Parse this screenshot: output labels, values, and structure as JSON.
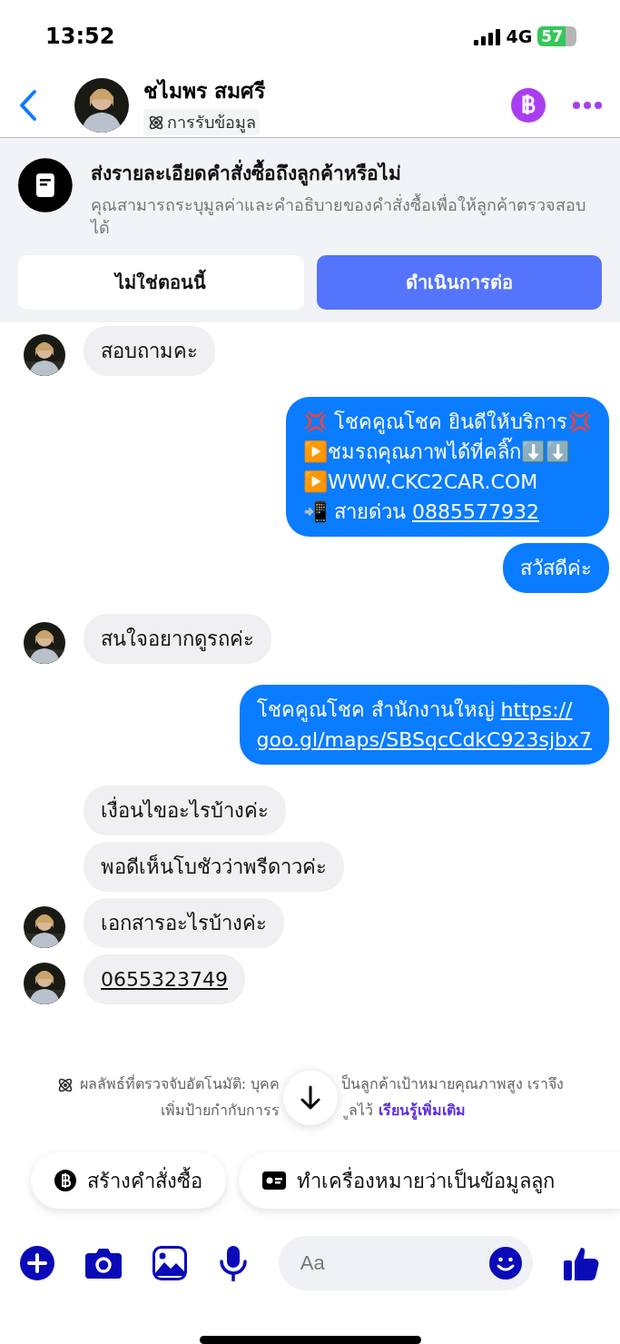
{
  "status_bar": {
    "time": "13:52",
    "network": "4G",
    "battery": "57"
  },
  "header": {
    "name": "ชไมพร สมศรี",
    "label": "การรับข้อมูล"
  },
  "banner": {
    "title": "ส่งรายละเอียดคำสั่งซื้อถึงลูกค้าหรือไม่",
    "body": "คุณสามารถระบุมูลค่าและคำอธิบายของคำสั่งซื้อเพื่อให้ลูกค้าตรวจสอบได้",
    "buttons": [
      {
        "label": "ไม่ใช่ตอนนี้",
        "kind": "secondary"
      },
      {
        "label": "ดำเนินการต่อ",
        "kind": "primary"
      }
    ]
  },
  "messages": [
    {
      "kind": "incoming",
      "avatar": true,
      "lines": [
        [
          {
            "text": "สอบถามคะ",
            "link": false
          }
        ]
      ]
    },
    {
      "kind": "outgoing",
      "lines": [
        [
          {
            "text": "💢 โชคคูณโชค ยินดีให้บริการ💢",
            "link": false
          }
        ],
        [
          {
            "text": "▶️ชมรถคุณภาพได้ที่คลิ๊ก⬇️⬇️",
            "link": false
          }
        ],
        [
          {
            "text": "▶️WWW.CKC2CAR.COM",
            "link": false
          }
        ],
        [
          {
            "text": "📲 สายด่วน ",
            "link": false
          },
          {
            "text": "0885577932",
            "link": true
          }
        ]
      ]
    },
    {
      "kind": "outgoing",
      "lines": [
        [
          {
            "text": "สวัสดีค่ะ",
            "link": false
          }
        ]
      ]
    },
    {
      "kind": "incoming",
      "avatar": true,
      "lines": [
        [
          {
            "text": "สนใจอยากดูรถค่ะ",
            "link": false
          }
        ]
      ]
    },
    {
      "kind": "outgoing",
      "lines": [
        [
          {
            "text": "โชคคูณโชค สำนักงานใหญ่ ",
            "link": false
          },
          {
            "text": "https://",
            "link": true
          }
        ],
        [
          {
            "text": "goo.gl/maps/SBSqcCdkC923sjbx7",
            "link": true
          }
        ]
      ]
    },
    {
      "kind": "incoming",
      "avatar": false,
      "lines": [
        [
          {
            "text": "เงื่อนไขอะไรบ้างค่ะ",
            "link": false
          }
        ]
      ]
    },
    {
      "kind": "incoming",
      "avatar": false,
      "lines": [
        [
          {
            "text": "พอดีเห็นโบชัวว่าพรีดาวค่ะ",
            "link": false
          }
        ]
      ]
    },
    {
      "kind": "incoming",
      "avatar": true,
      "lines": [
        [
          {
            "text": "เอกสารอะไรบ้างค่ะ",
            "link": false
          }
        ]
      ]
    },
    {
      "kind": "incoming",
      "avatar": true,
      "lines": [
        [
          {
            "text": "0655323749",
            "link": true
          }
        ]
      ]
    }
  ],
  "notice": {
    "line1_left": "ผลลัพธ์ที่ตรวจจับอัตโนมัติ: บุคค",
    "line1_right": "ป็นลูกค้าเป้าหมายคุณภาพสูง เราจึง",
    "line2_left": "เพิ่มป้ายกำกับการร",
    "line2_right": "ูลไว้",
    "link": "เรียนรู้เพิ่มเติม"
  },
  "chips": [
    {
      "label": "สร้างคำสั่งซื้อ",
      "kind": "order"
    },
    {
      "label": "ทำเครื่องหมายว่าเป็นข้อมูลลูก",
      "kind": "lead"
    }
  ],
  "composer": {
    "placeholder": "Aa"
  }
}
